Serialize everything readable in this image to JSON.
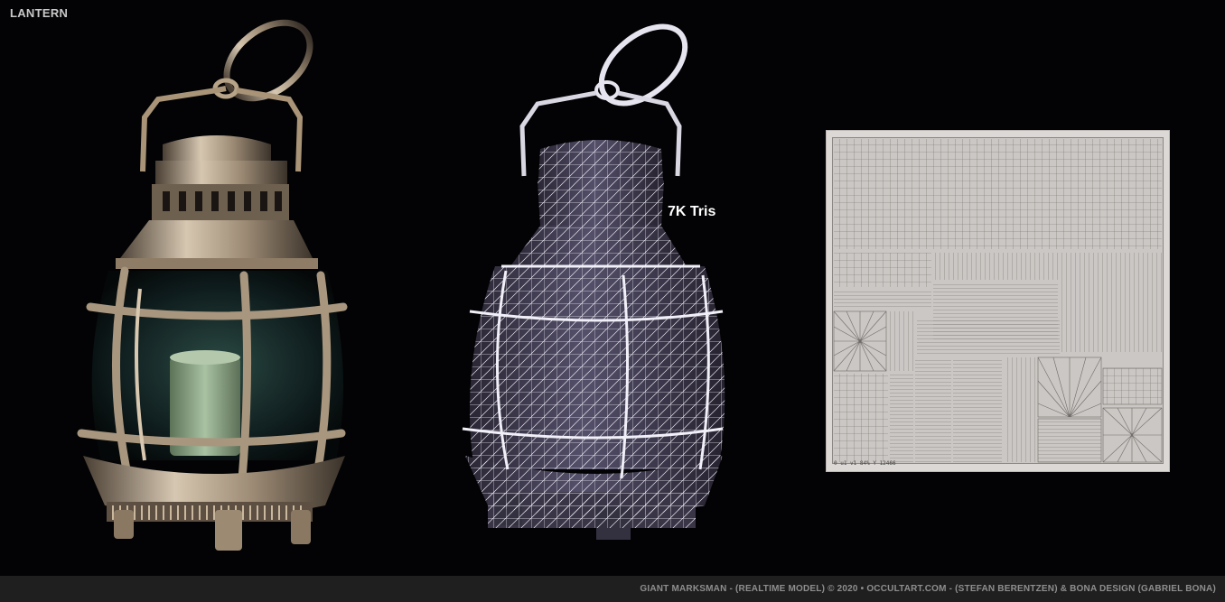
{
  "title": "LANTERN",
  "tris_label": "7K Tris",
  "uv_status": "0 u1 v1 84%  Y  12466",
  "footer": {
    "credits": "GIANT MARKSMAN - (REALTIME MODEL) © 2020    •   OCCULTART.COM - (STEFAN BERENTZEN)  &  BONA DESIGN (GABRIEL BONA)"
  },
  "colors": {
    "background": "#030305",
    "footer_bg": "#1f1f1f",
    "metal": "#b8a58c",
    "wire_fill": "#3f3a4c",
    "wire_line": "#e6e4ee",
    "candle": "#8fa88a",
    "uv_bg": "#cbc7c4"
  },
  "icons": [
    "lantern-render-image",
    "lantern-wireframe-image",
    "uv-layout-image"
  ]
}
